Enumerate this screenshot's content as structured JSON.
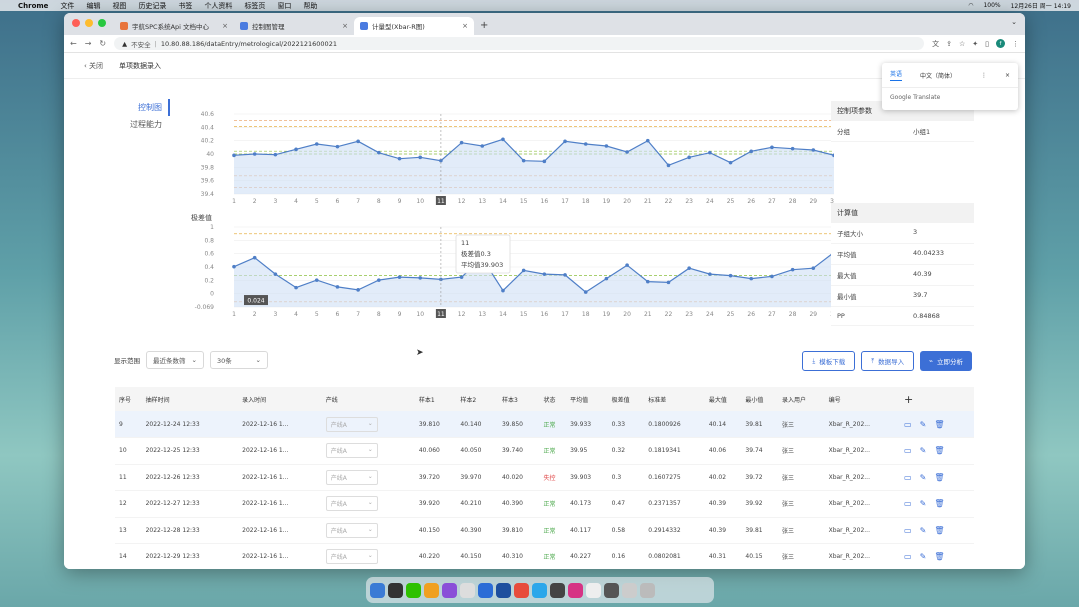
{
  "menubar": {
    "app": "Chrome",
    "items": [
      "文件",
      "编辑",
      "视图",
      "历史记录",
      "书签",
      "个人资料",
      "标签页",
      "窗口",
      "帮助"
    ],
    "battery": "100%",
    "clock": "12月26日 周一  14:19"
  },
  "browser": {
    "tabs": [
      {
        "title": "宇航SPC系统Api 文档中心",
        "color": "#e8743b"
      },
      {
        "title": "控制图管理",
        "color": "#4a7be0"
      },
      {
        "title": "计量型(Xbar-R图)",
        "color": "#4a7be0"
      }
    ],
    "url_insecure": "不安全",
    "url": "10.80.88.186/dataEntry/metrological/2022121600021",
    "profile_initial": "f"
  },
  "translate_popup": {
    "tab_en": "英语",
    "tab_zh": "中文（简体）",
    "brand": "Google Translate"
  },
  "page": {
    "back_label": "关闭",
    "title": "单项数据录入",
    "nav": [
      "控制图",
      "过程能力"
    ]
  },
  "chart_data": [
    {
      "type": "line",
      "title": "平均值",
      "x": [
        1,
        2,
        3,
        4,
        5,
        6,
        7,
        8,
        9,
        10,
        11,
        12,
        13,
        14,
        15,
        16,
        17,
        18,
        19,
        20,
        21,
        22,
        23,
        24,
        25,
        26,
        27,
        28,
        29,
        30
      ],
      "y": [
        39.98,
        40.0,
        39.99,
        40.07,
        40.15,
        40.11,
        40.19,
        40.02,
        39.93,
        39.95,
        39.9,
        40.17,
        40.12,
        40.22,
        39.9,
        39.89,
        40.19,
        40.15,
        40.12,
        40.03,
        40.2,
        39.83,
        39.95,
        40.02,
        39.87,
        40.04,
        40.1,
        40.08,
        40.06,
        39.98
      ],
      "ylim": [
        39.4,
        40.6
      ],
      "yticks": [
        "40.6",
        "40.4",
        "40.2",
        "40",
        "39.8",
        "39.6",
        "39.4"
      ],
      "limits": [
        {
          "label": "USL:40.5",
          "value": 40.5,
          "color": "#e89a5a"
        },
        {
          "label": "UCL:40.41204",
          "value": 40.41204,
          "color": "#e8b24a"
        },
        {
          "label": "CL:40.04233",
          "value": 40.04233,
          "color": "#8cbf3f"
        },
        {
          "label": "Target:40",
          "value": 40.0,
          "color": "#8cbf3f"
        },
        {
          "label": "LCL:39.67262",
          "value": 39.67262,
          "color": "#e89a5a"
        },
        {
          "label": "LSL:39.5",
          "value": 39.5,
          "color": "#e89a5a"
        }
      ]
    },
    {
      "type": "line",
      "title": "极差值",
      "x": [
        1,
        2,
        3,
        4,
        5,
        6,
        7,
        8,
        9,
        10,
        11,
        12,
        13,
        14,
        15,
        16,
        17,
        18,
        19,
        20,
        21,
        22,
        23,
        24,
        25,
        26,
        27,
        28,
        29,
        30
      ],
      "y": [
        0.47,
        0.59,
        0.37,
        0.19,
        0.29,
        0.2,
        0.16,
        0.29,
        0.33,
        0.32,
        0.3,
        0.33,
        0.58,
        0.15,
        0.42,
        0.37,
        0.36,
        0.13,
        0.31,
        0.49,
        0.27,
        0.26,
        0.45,
        0.37,
        0.35,
        0.31,
        0.34,
        0.43,
        0.45,
        0.66
      ],
      "ylim": [
        -0.069,
        1.0
      ],
      "yticks": [
        "1",
        "0.8",
        "0.6",
        "0.4",
        "0.2",
        "0",
        "-0.069"
      ],
      "limits": [
        {
          "label": "UCL:0.90946",
          "value": 0.90946,
          "color": "#e8b24a"
        },
        {
          "label": "CL:0.35333",
          "value": 0.35333,
          "color": "#8cbf3f"
        },
        {
          "label": "LCL:0",
          "value": 0,
          "color": "#e89a5a"
        }
      ],
      "crosshair_value": "0.024",
      "tooltip": {
        "title": "11",
        "line1": "极差值0.3",
        "line2": "平均值39.903"
      }
    }
  ],
  "crosshair_x_label": "11",
  "params": {
    "header": "控制项参数",
    "rows": [
      {
        "k": "分组",
        "v": "小组1"
      }
    ]
  },
  "stats": {
    "header": "计算值",
    "rows": [
      {
        "k": "子组大小",
        "v": "3"
      },
      {
        "k": "平均值",
        "v": "40.04233"
      },
      {
        "k": "最大值",
        "v": "40.39"
      },
      {
        "k": "最小值",
        "v": "39.7"
      },
      {
        "k": "PP",
        "v": "0.84868"
      }
    ]
  },
  "filter": {
    "label": "显示范围",
    "mode": "最近条数筛",
    "count": "30条"
  },
  "buttons": {
    "template_download": "模板下载",
    "data_import": "数据导入",
    "analyze": "立即分析"
  },
  "table": {
    "headers": [
      "序号",
      "抽样时间",
      "录入时间",
      "产线",
      "样本1",
      "样本2",
      "样本3",
      "状态",
      "平均值",
      "极差值",
      "标准差",
      "最大值",
      "最小值",
      "录入用户",
      "编号"
    ],
    "add_symbol": "+",
    "rows": [
      [
        "9",
        "2022-12-24 12:33",
        "2022-12-16 1...",
        "产线A",
        "39.810",
        "40.140",
        "39.850",
        "正常",
        "39.933",
        "0.33",
        "0.1800926",
        "40.14",
        "39.81",
        "张三",
        "Xbar_R_202..."
      ],
      [
        "10",
        "2022-12-25 12:33",
        "2022-12-16 1...",
        "产线A",
        "40.060",
        "40.050",
        "39.740",
        "正常",
        "39.95",
        "0.32",
        "0.1819341",
        "40.06",
        "39.74",
        "张三",
        "Xbar_R_202..."
      ],
      [
        "11",
        "2022-12-26 12:33",
        "2022-12-16 1...",
        "产线A",
        "39.720",
        "39.970",
        "40.020",
        "失控",
        "39.903",
        "0.3",
        "0.1607275",
        "40.02",
        "39.72",
        "张三",
        "Xbar_R_202..."
      ],
      [
        "12",
        "2022-12-27 12:33",
        "2022-12-16 1...",
        "产线A",
        "39.920",
        "40.210",
        "40.390",
        "正常",
        "40.173",
        "0.47",
        "0.2371357",
        "40.39",
        "39.92",
        "张三",
        "Xbar_R_202..."
      ],
      [
        "13",
        "2022-12-28 12:33",
        "2022-12-16 1...",
        "产线A",
        "40.150",
        "40.390",
        "39.810",
        "正常",
        "40.117",
        "0.58",
        "0.2914332",
        "40.39",
        "39.81",
        "张三",
        "Xbar_R_202..."
      ],
      [
        "14",
        "2022-12-29 12:33",
        "2022-12-16 1...",
        "产线A",
        "40.220",
        "40.150",
        "40.310",
        "正常",
        "40.227",
        "0.16",
        "0.0802081",
        "40.31",
        "40.15",
        "张三",
        "Xbar_R_202..."
      ]
    ]
  }
}
